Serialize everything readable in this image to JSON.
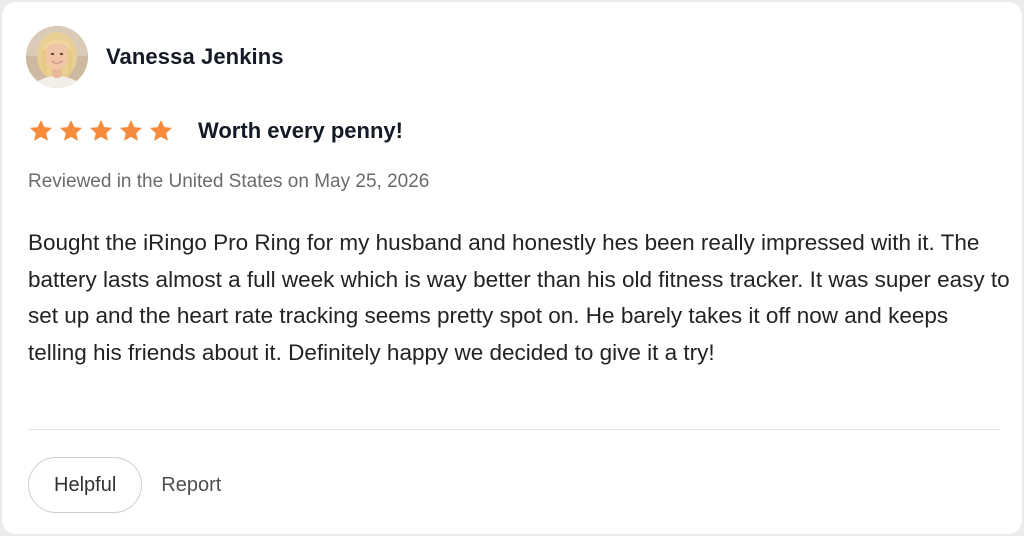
{
  "reviewer": {
    "name": "Vanessa Jenkins",
    "avatar_icon": "user-photo"
  },
  "rating": {
    "stars": 5,
    "max_stars": 5,
    "star_color": "#f78b3d"
  },
  "review": {
    "title": "Worth every penny!",
    "meta": "Reviewed in the United States on May 25, 2026",
    "body": "Bought the iRingo Pro Ring for my husband and honestly hes been really impressed with it. The battery lasts almost a full week which is way better than his old fitness tracker. It was super easy to set up and the heart rate tracking seems pretty spot on. He barely takes it off now and keeps telling his friends about it. Definitely happy we decided to give it a try!"
  },
  "actions": {
    "helpful_label": "Helpful",
    "report_label": "Report"
  }
}
